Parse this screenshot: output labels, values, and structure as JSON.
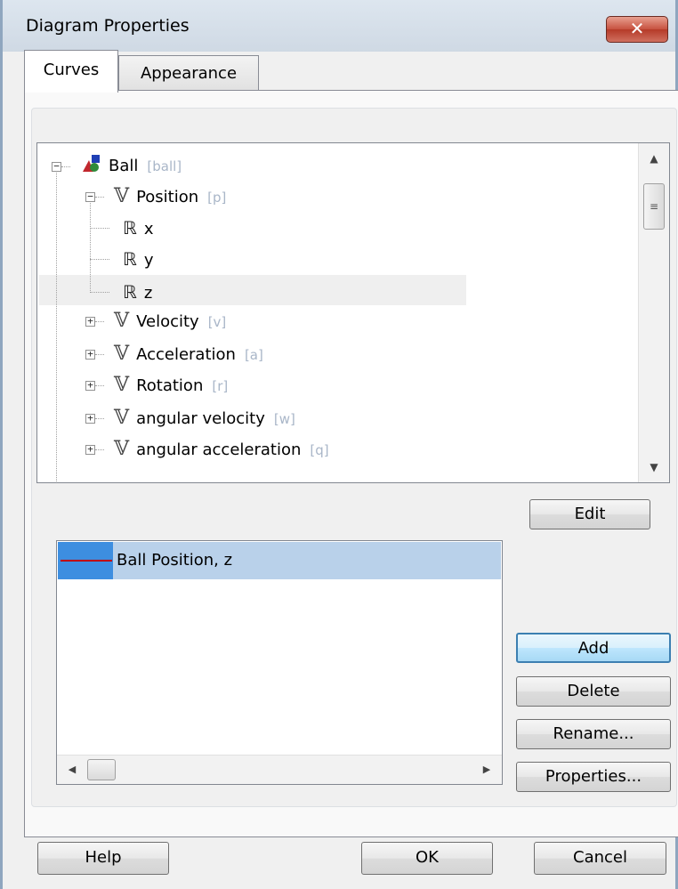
{
  "window": {
    "title": "Diagram Properties",
    "close_symbol": "✕"
  },
  "tabs": [
    {
      "label": "Curves",
      "active": true
    },
    {
      "label": "Appearance",
      "active": false
    }
  ],
  "tree": {
    "root": {
      "label": "Ball",
      "alias": "[ball]",
      "expanded": true,
      "icon": "rigid-body-icon"
    },
    "position": {
      "label": "Position",
      "alias": "[p]",
      "expanded": true,
      "children": [
        {
          "label": "x",
          "symbol": "ℝ"
        },
        {
          "label": "y",
          "symbol": "ℝ"
        },
        {
          "label": "z",
          "symbol": "ℝ",
          "selected": true
        }
      ]
    },
    "vectors": [
      {
        "label": "Velocity",
        "alias": "[v]"
      },
      {
        "label": "Acceleration",
        "alias": "[a]"
      },
      {
        "label": "Rotation",
        "alias": "[r]"
      },
      {
        "label": "angular velocity",
        "alias": "[w]"
      },
      {
        "label": "angular acceleration",
        "alias": "[q]"
      }
    ],
    "vector_symbol": "𝕍",
    "collapsed_symbol": "+",
    "expanded_symbol": "−"
  },
  "buttons": {
    "edit": "Edit",
    "add": "Add",
    "delete": "Delete",
    "rename": "Rename...",
    "properties": "Properties...",
    "help": "Help",
    "ok": "OK",
    "cancel": "Cancel"
  },
  "curves": [
    {
      "label": "Ball Position, z",
      "color": "#c00000",
      "selected": true
    }
  ],
  "colors": {
    "selection": "#b9d1ea",
    "swatch_bg": "#3d8ee0",
    "alias_text": "#a9b6c8",
    "default_button_border": "#3c7fb1"
  }
}
